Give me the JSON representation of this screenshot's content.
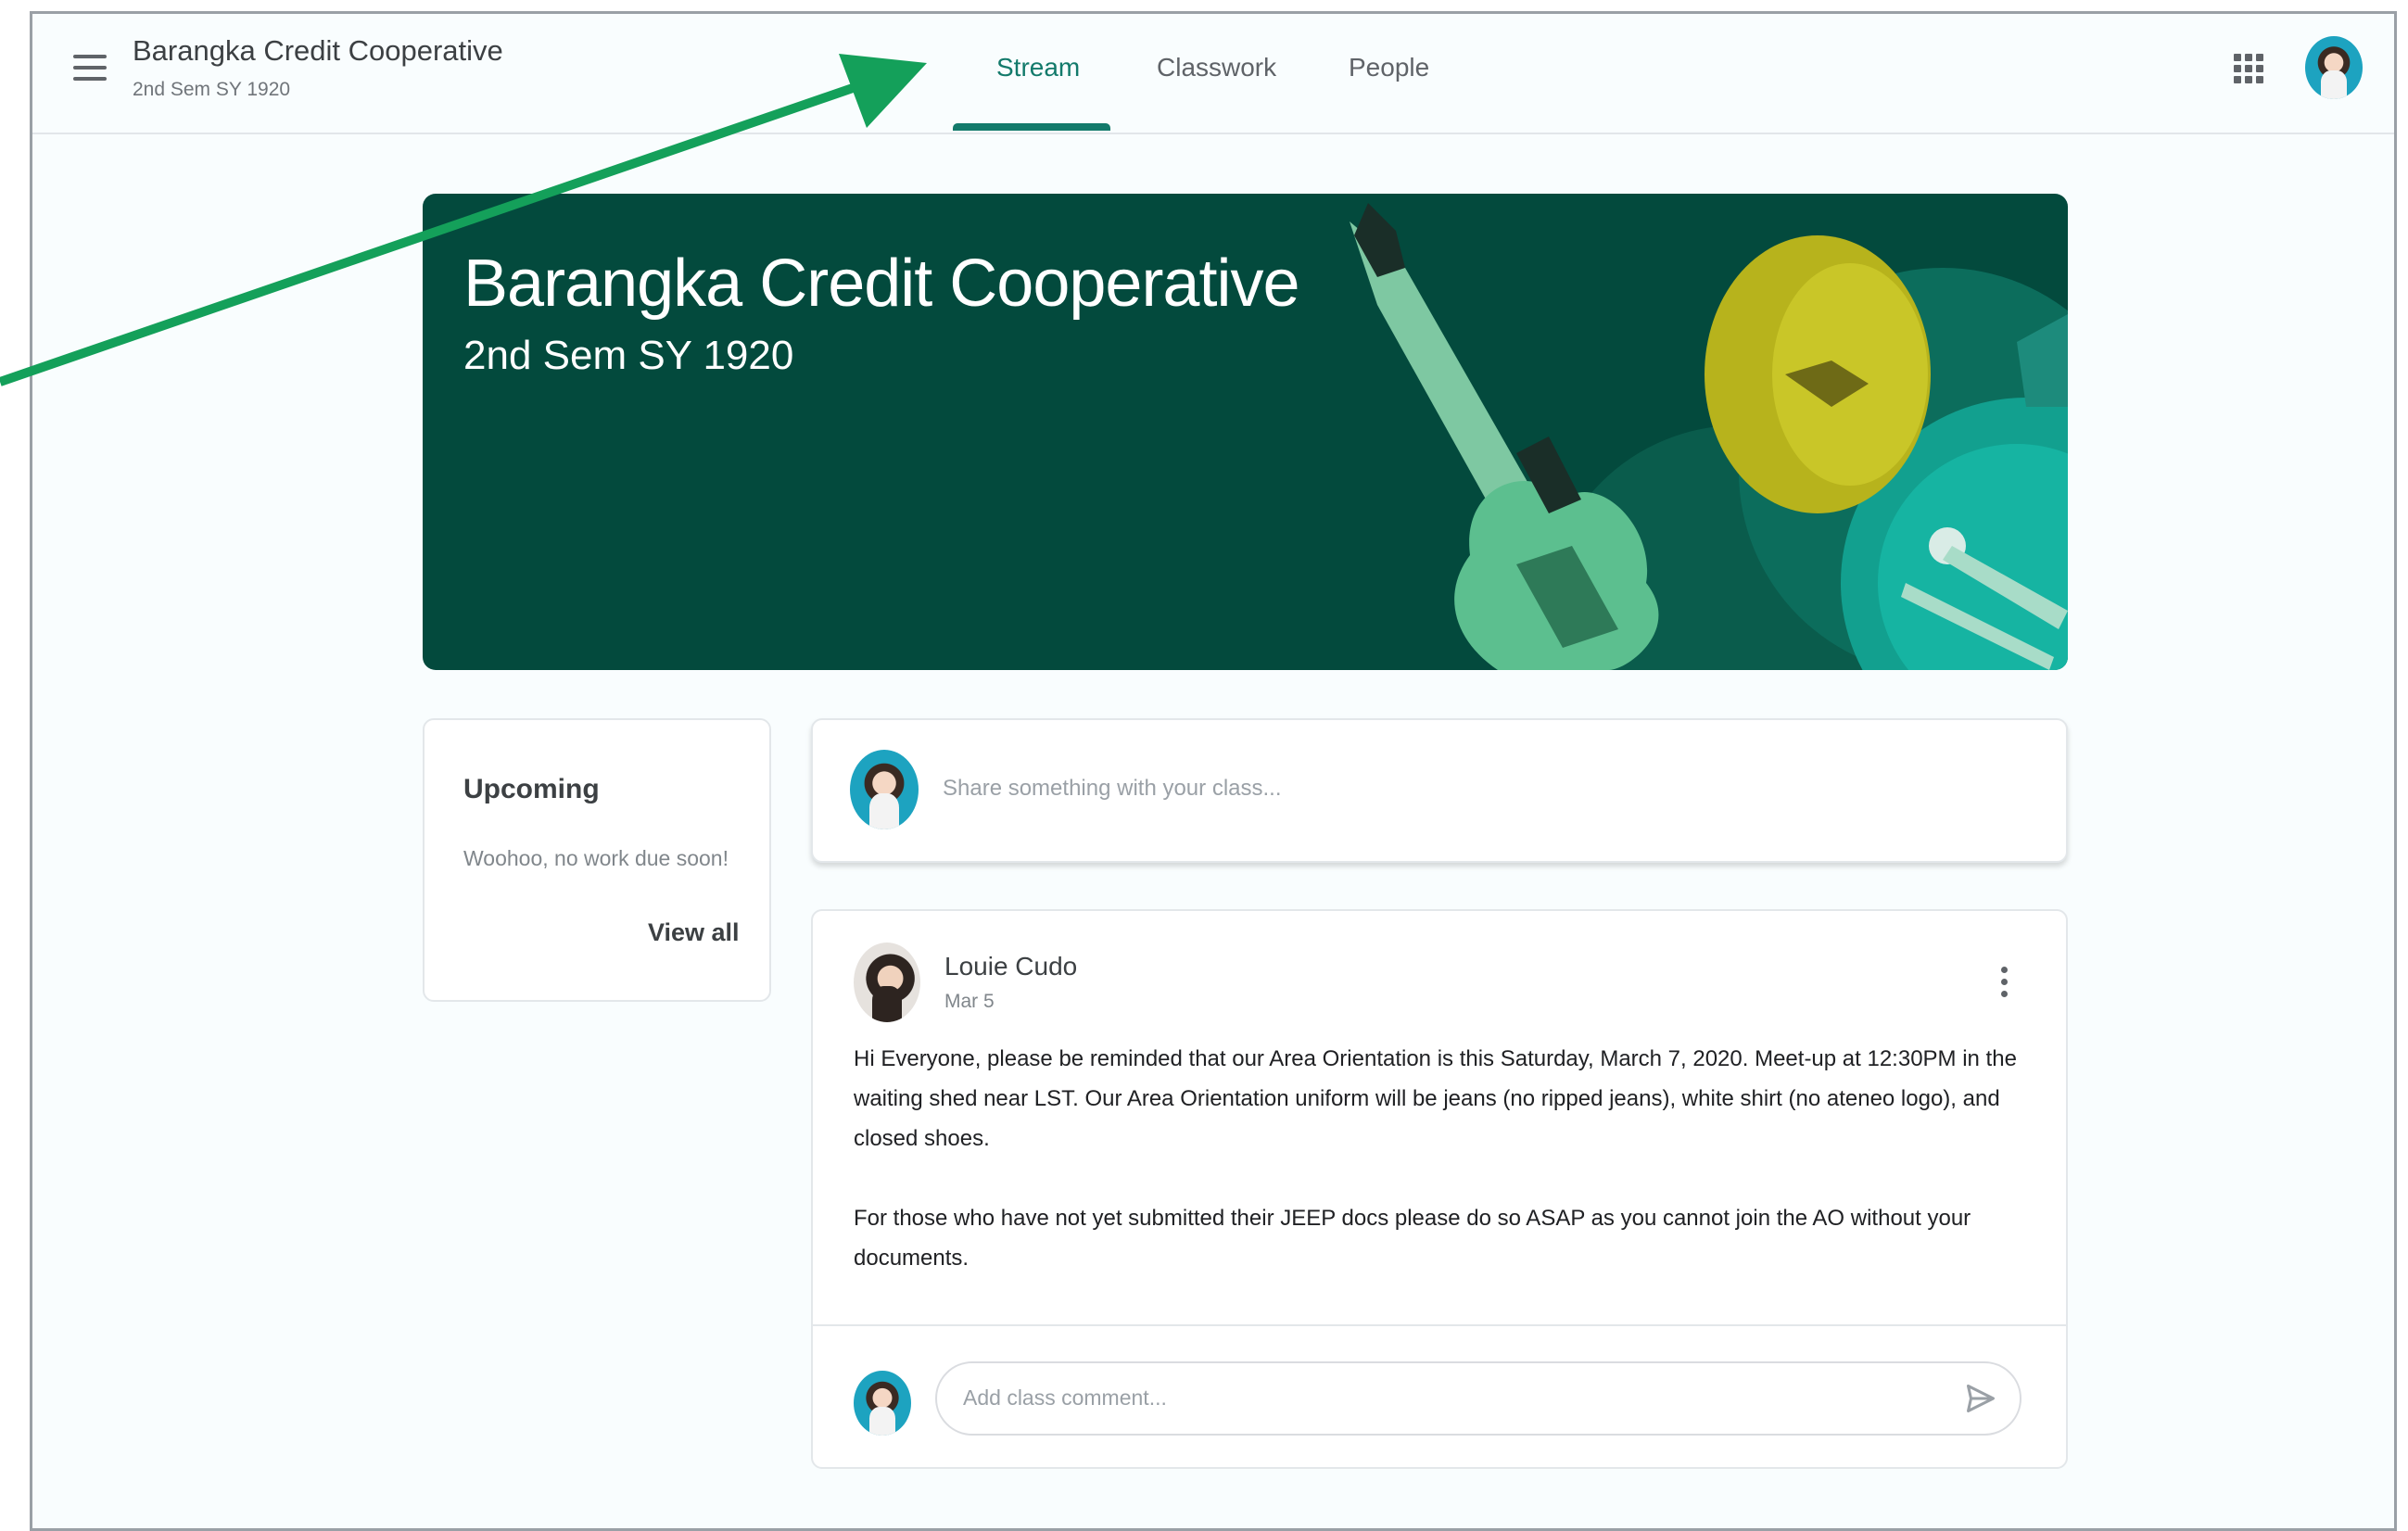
{
  "header": {
    "class_name": "Barangka Credit Cooperative",
    "class_section": "2nd Sem SY 1920",
    "tabs": [
      {
        "label": "Stream"
      },
      {
        "label": "Classwork"
      },
      {
        "label": "People"
      }
    ]
  },
  "banner": {
    "title": "Barangka Credit Cooperative",
    "subtitle": "2nd Sem SY 1920"
  },
  "upcoming": {
    "title": "Upcoming",
    "message": "Woohoo, no work due soon!",
    "view_all": "View all"
  },
  "share": {
    "placeholder": "Share something with your class..."
  },
  "post": {
    "author": "Louie Cudo",
    "date": "Mar 5",
    "paragraph1": "Hi Everyone, please be reminded that our Area Orientation is this Saturday, March 7, 2020. Meet-up at 12:30PM in the waiting shed near LST. Our Area Orientation uniform will be jeans (no ripped jeans), white shirt (no ateneo logo), and closed shoes.",
    "paragraph2": "For those who have not yet submitted their JEEP docs please do so ASAP as you cannot join the AO without your documents.",
    "comment_placeholder": "Add class comment..."
  },
  "colors": {
    "accent": "#137a6b",
    "banner": "#034a3d",
    "annotation_arrow": "#14a05a"
  },
  "icons": [
    "menu-icon",
    "apps-grid-icon",
    "more-vert-icon",
    "send-icon"
  ]
}
